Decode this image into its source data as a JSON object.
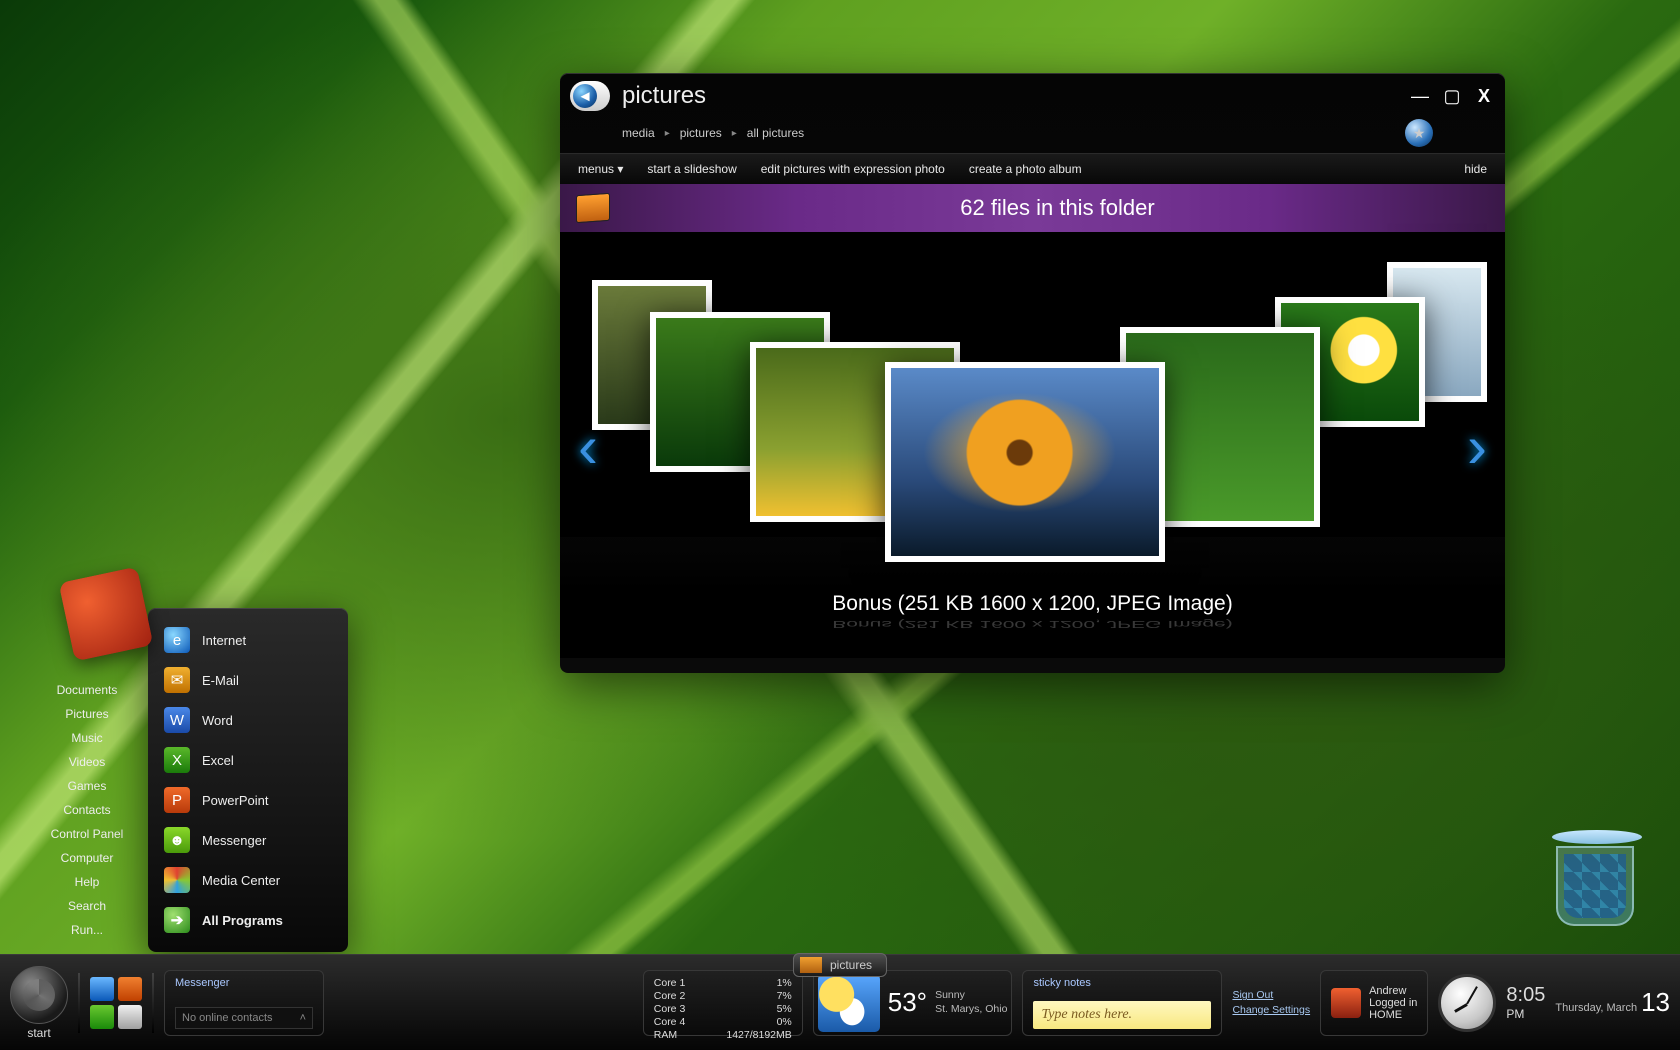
{
  "window": {
    "title": "pictures",
    "breadcrumb": [
      "media",
      "pictures",
      "all pictures"
    ],
    "toolbar": {
      "menus": "menus ▾",
      "slideshow": "start a slideshow",
      "edit": "edit pictures with expression photo",
      "album": "create a photo album",
      "hide": "hide"
    },
    "folder_count": "62 files in this folder",
    "caption": "Bonus  (251 KB 1600 x 1200, JPEG Image)",
    "controls": {
      "min": "—",
      "max": "▢",
      "close": "X"
    }
  },
  "start_menu": {
    "left": [
      "Documents",
      "Pictures",
      "Music",
      "Videos",
      "Games",
      "Contacts",
      "Control Panel",
      "Computer",
      "Help",
      "Search",
      "Run..."
    ],
    "right": [
      {
        "label": "Internet",
        "icon": "i-ie"
      },
      {
        "label": "E-Mail",
        "icon": "i-mail"
      },
      {
        "label": "Word",
        "icon": "i-word"
      },
      {
        "label": "Excel",
        "icon": "i-xl"
      },
      {
        "label": "PowerPoint",
        "icon": "i-pp"
      },
      {
        "label": "Messenger",
        "icon": "i-msg"
      },
      {
        "label": "Media Center",
        "icon": "i-mc"
      }
    ],
    "all_programs": "All Programs"
  },
  "taskbar": {
    "start": "start",
    "task_item": "pictures",
    "messenger": {
      "hdr": "Messenger",
      "status": "No online contacts"
    },
    "cores": {
      "hdr_rows": [
        {
          "l": "Core 1",
          "v": "1%"
        },
        {
          "l": "Core 2",
          "v": "7%"
        },
        {
          "l": "Core 3",
          "v": "5%"
        },
        {
          "l": "Core 4",
          "v": "0%"
        }
      ],
      "ram": {
        "l": "RAM",
        "v": "1427/8192MB"
      }
    },
    "weather": {
      "temp": "53°",
      "cond": "Sunny",
      "loc": "St. Marys, Ohio"
    },
    "notes": {
      "hdr": "sticky notes",
      "text": "Type notes here."
    },
    "sys": {
      "signout": "Sign Out",
      "settings": "Change Settings"
    },
    "user": {
      "name": "Andrew",
      "status": "Logged in",
      "where": "HOME"
    },
    "clock": {
      "time": "8:05",
      "ampm": "PM",
      "day": "Thursday, March",
      "date": "13"
    }
  }
}
